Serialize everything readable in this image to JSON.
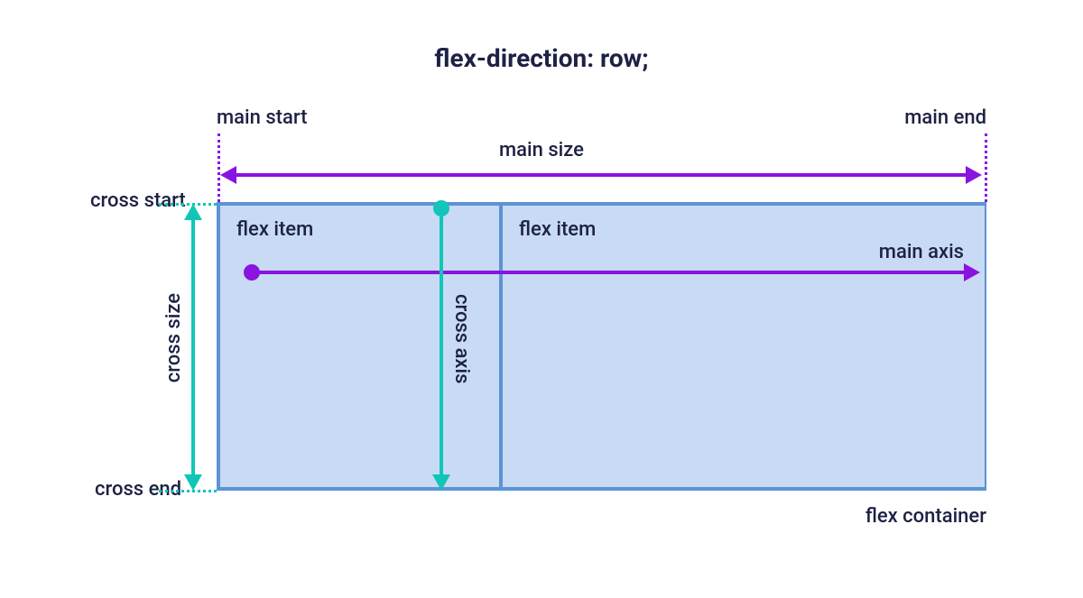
{
  "title": "flex-direction: row;",
  "labels": {
    "main_start": "main start",
    "main_end": "main end",
    "main_size": "main size",
    "main_axis": "main axis",
    "cross_start": "cross start",
    "cross_end": "cross end",
    "cross_size": "cross size",
    "cross_axis": "cross axis",
    "flex_container": "flex container",
    "flex_item": "flex item"
  },
  "colors": {
    "text": "#1d2144",
    "container_border": "#5c93d6",
    "container_fill": "#c8daf4",
    "main": "#8a13e0",
    "cross": "#11c6b8"
  }
}
